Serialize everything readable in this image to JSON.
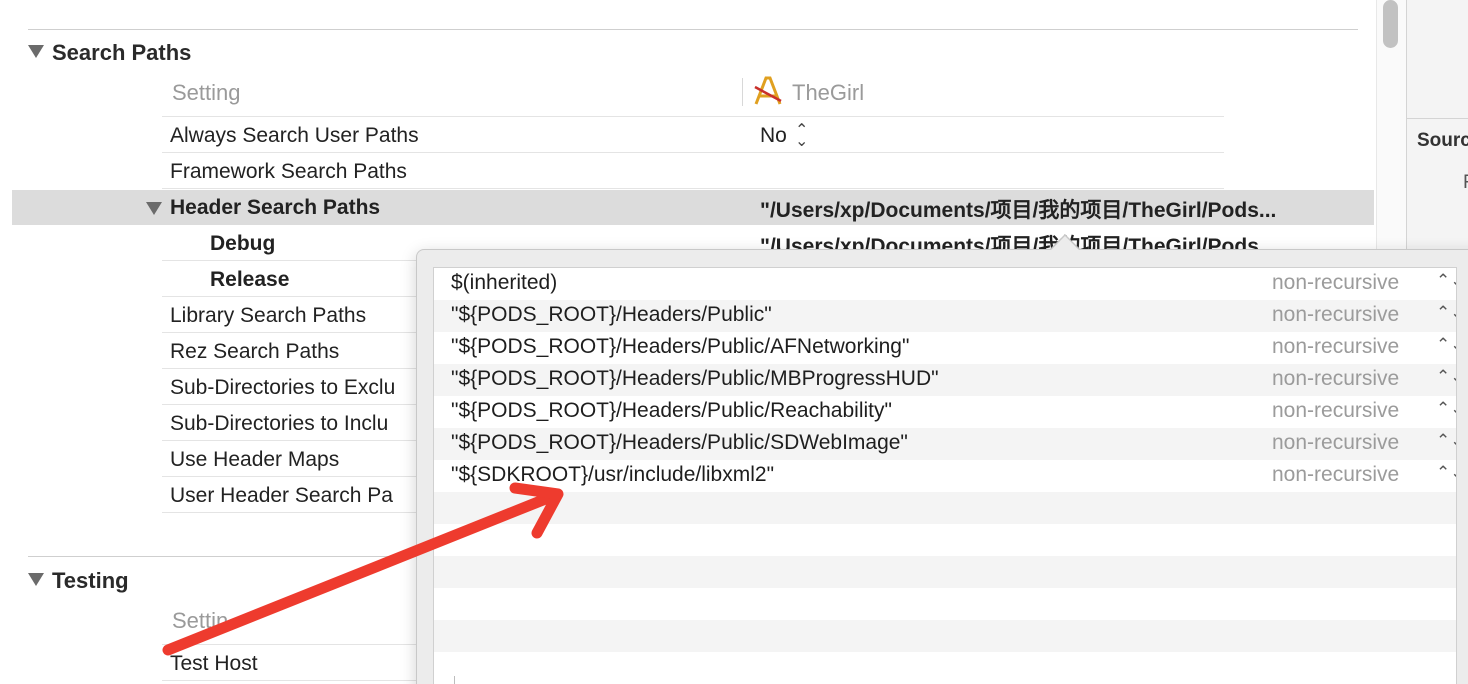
{
  "search_paths": {
    "title": "Search Paths",
    "col_setting": "Setting",
    "col_target": "TheGirl",
    "rows": [
      {
        "label": "Always Search User Paths",
        "value": "No"
      },
      {
        "label": "Framework Search Paths",
        "value": ""
      },
      {
        "label": "Header Search Paths",
        "value": "\"/Users/xp/Documents/项目/我的项目/TheGirl/Pods..."
      },
      {
        "label": "Debug",
        "value": "\"/Users/xp/Documents/项目/我的项目/TheGirl/Pods..."
      },
      {
        "label": "Release",
        "value": ""
      },
      {
        "label": "Library Search Paths",
        "value": ""
      },
      {
        "label": "Rez Search Paths",
        "value": ""
      },
      {
        "label": "Sub-Directories to Exclu",
        "value": ""
      },
      {
        "label": "Sub-Directories to Inclu",
        "value": ""
      },
      {
        "label": "Use Header Maps",
        "value": ""
      },
      {
        "label": "User Header Search Pa",
        "value": ""
      }
    ]
  },
  "testing": {
    "title": "Testing",
    "col_setting": "Settin",
    "rows": [
      {
        "label": "Test Host"
      }
    ]
  },
  "inspector": {
    "heading": "Sourc",
    "letter": "F"
  },
  "popover": {
    "entries": [
      {
        "path": "$(inherited)",
        "recursion": "non-recursive"
      },
      {
        "path": "\"${PODS_ROOT}/Headers/Public\"",
        "recursion": "non-recursive"
      },
      {
        "path": "\"${PODS_ROOT}/Headers/Public/AFNetworking\"",
        "recursion": "non-recursive"
      },
      {
        "path": "\"${PODS_ROOT}/Headers/Public/MBProgressHUD\"",
        "recursion": "non-recursive"
      },
      {
        "path": "\"${PODS_ROOT}/Headers/Public/Reachability\"",
        "recursion": "non-recursive"
      },
      {
        "path": "\"${PODS_ROOT}/Headers/Public/SDWebImage\"",
        "recursion": "non-recursive"
      },
      {
        "path": "\"${SDKROOT}/usr/include/libxml2\"",
        "recursion": "non-recursive"
      }
    ]
  },
  "colors": {
    "annotation_arrow": "#ee3b2e",
    "selected_row": "#dcdcdc"
  },
  "icons": {
    "stepper": "⌃⌄",
    "target": "app-target-icon"
  }
}
